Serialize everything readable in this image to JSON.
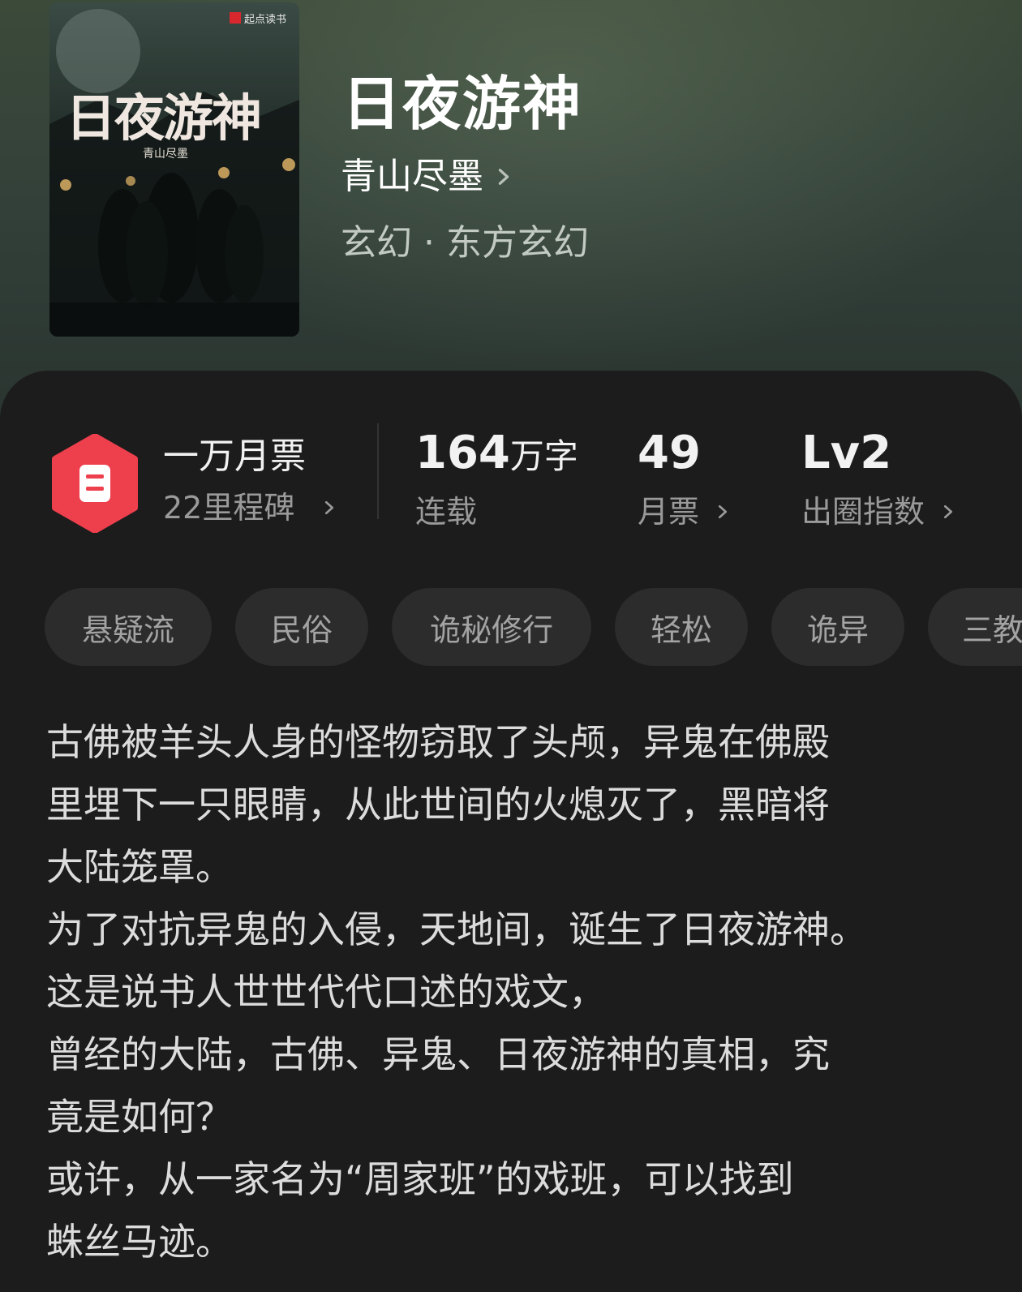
{
  "book": {
    "title": "日夜游神",
    "author": "青山尽墨",
    "genre": "玄幻 · 东方玄幻",
    "cover": {
      "brand": "起点读书",
      "title": "日夜游神",
      "author": "青山尽墨"
    }
  },
  "stats": {
    "milestone_title": "一万月票",
    "milestone_sub": "22里程碑",
    "word_count_num": "164",
    "word_count_unit": "万字",
    "status": "连载",
    "monthly_votes": "49",
    "monthly_votes_label": "月票",
    "level": "Lv2",
    "level_label": "出圈指数"
  },
  "tags": [
    "悬疑流",
    "民俗",
    "诡秘修行",
    "轻松",
    "诡异",
    "三教"
  ],
  "description": [
    "古佛被羊头人身的怪物窃取了头颅，异鬼在佛殿",
    "里埋下一只眼睛，从此世间的火熄灭了，黑暗将",
    "大陆笼罩。",
    "为了对抗异鬼的入侵，天地间，诞生了日夜游神。",
    "这是说书人世世代代口述的戏文，",
    "曾经的大陆，古佛、异鬼、日夜游神的真相，究",
    "竟是如何？",
    "或许，从一家名为“周家班”的戏班，可以找到",
    "蛛丝马迹。"
  ],
  "colors": {
    "badge_red": "#ee3f4d",
    "panel_bg": "#1c1c1c",
    "hero_green": "#33413a"
  }
}
